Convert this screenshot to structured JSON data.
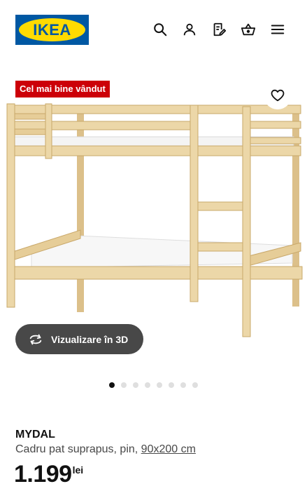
{
  "header": {
    "logo_text": "IKEA",
    "icons": [
      "search-icon",
      "user-icon",
      "shopping-list-icon",
      "basket-icon",
      "menu-icon"
    ]
  },
  "badge": {
    "label": "Cel mai bine vândut"
  },
  "actions": {
    "view3d_label": "Vizualizare în 3D"
  },
  "gallery": {
    "total_images": 8,
    "active_index": 0
  },
  "product": {
    "name": "MYDAL",
    "description": "Cadru pat suprapus, pin, ",
    "size": "90x200 cm",
    "price": "1.199",
    "currency": "lei"
  },
  "colors": {
    "brand_blue": "#0058a3",
    "brand_yellow": "#ffdb00",
    "badge_red": "#cc0008",
    "button_dark": "#484848",
    "wood": "#ecd7a8"
  }
}
